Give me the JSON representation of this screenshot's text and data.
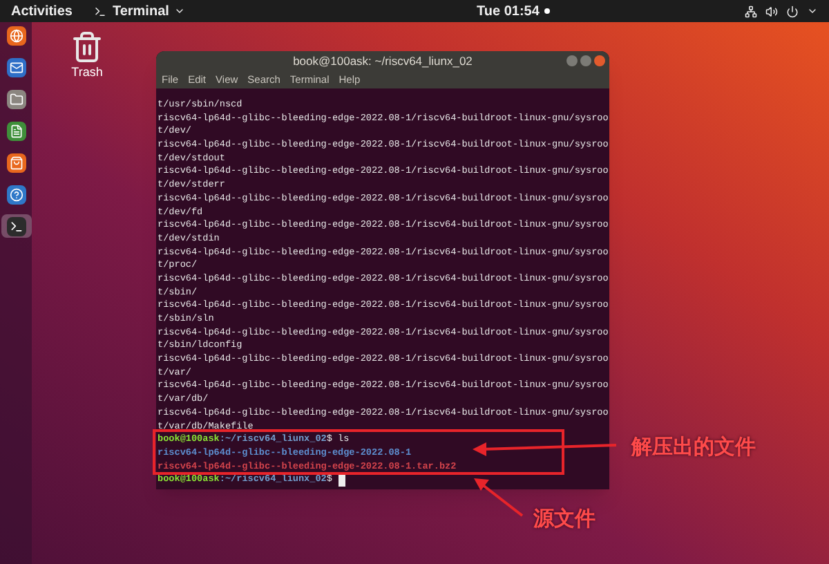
{
  "top_bar": {
    "activities": "Activities",
    "app_menu": "Terminal",
    "clock": "Tue 01:54"
  },
  "dock": {
    "items": [
      {
        "kind": "browser",
        "selected": false
      },
      {
        "kind": "mail",
        "selected": false
      },
      {
        "kind": "files",
        "selected": false
      },
      {
        "kind": "office",
        "selected": false
      },
      {
        "kind": "store",
        "selected": false
      },
      {
        "kind": "help",
        "selected": false
      },
      {
        "kind": "terminal",
        "selected": true
      }
    ]
  },
  "desktop_icons": [
    {
      "label": "Trash"
    }
  ],
  "terminal": {
    "title": "book@100ask: ~/riscv64_liunx_02",
    "menu": [
      "File",
      "Edit",
      "View",
      "Search",
      "Terminal",
      "Help"
    ],
    "lines": [
      {
        "kind": "output",
        "text": "t/usr/sbin/nscd"
      },
      {
        "kind": "output",
        "text": "riscv64-lp64d--glibc--bleeding-edge-2022.08-1/riscv64-buildroot-linux-gnu/sysroo"
      },
      {
        "kind": "output",
        "text": "t/dev/"
      },
      {
        "kind": "output",
        "text": "riscv64-lp64d--glibc--bleeding-edge-2022.08-1/riscv64-buildroot-linux-gnu/sysroo"
      },
      {
        "kind": "output",
        "text": "t/dev/stdout"
      },
      {
        "kind": "output",
        "text": "riscv64-lp64d--glibc--bleeding-edge-2022.08-1/riscv64-buildroot-linux-gnu/sysroo"
      },
      {
        "kind": "output",
        "text": "t/dev/stderr"
      },
      {
        "kind": "output",
        "text": "riscv64-lp64d--glibc--bleeding-edge-2022.08-1/riscv64-buildroot-linux-gnu/sysroo"
      },
      {
        "kind": "output",
        "text": "t/dev/fd"
      },
      {
        "kind": "output",
        "text": "riscv64-lp64d--glibc--bleeding-edge-2022.08-1/riscv64-buildroot-linux-gnu/sysroo"
      },
      {
        "kind": "output",
        "text": "t/dev/stdin"
      },
      {
        "kind": "output",
        "text": "riscv64-lp64d--glibc--bleeding-edge-2022.08-1/riscv64-buildroot-linux-gnu/sysroo"
      },
      {
        "kind": "output",
        "text": "t/proc/"
      },
      {
        "kind": "output",
        "text": "riscv64-lp64d--glibc--bleeding-edge-2022.08-1/riscv64-buildroot-linux-gnu/sysroo"
      },
      {
        "kind": "output",
        "text": "t/sbin/"
      },
      {
        "kind": "output",
        "text": "riscv64-lp64d--glibc--bleeding-edge-2022.08-1/riscv64-buildroot-linux-gnu/sysroo"
      },
      {
        "kind": "output",
        "text": "t/sbin/sln"
      },
      {
        "kind": "output",
        "text": "riscv64-lp64d--glibc--bleeding-edge-2022.08-1/riscv64-buildroot-linux-gnu/sysroo"
      },
      {
        "kind": "output",
        "text": "t/sbin/ldconfig"
      },
      {
        "kind": "output",
        "text": "riscv64-lp64d--glibc--bleeding-edge-2022.08-1/riscv64-buildroot-linux-gnu/sysroo"
      },
      {
        "kind": "output",
        "text": "t/var/"
      },
      {
        "kind": "output",
        "text": "riscv64-lp64d--glibc--bleeding-edge-2022.08-1/riscv64-buildroot-linux-gnu/sysroo"
      },
      {
        "kind": "output",
        "text": "t/var/db/"
      },
      {
        "kind": "output",
        "text": "riscv64-lp64d--glibc--bleeding-edge-2022.08-1/riscv64-buildroot-linux-gnu/sysroo"
      },
      {
        "kind": "output",
        "text": "t/var/db/Makefile"
      },
      {
        "kind": "prompt",
        "user": "book@100ask",
        "path": ":~/riscv64_liunx_02",
        "command": "$ ls",
        "cursor": false
      },
      {
        "kind": "directory",
        "text": "riscv64-lp64d--glibc--bleeding-edge-2022.08-1"
      },
      {
        "kind": "archive",
        "text": "riscv64-lp64d--glibc--bleeding-edge-2022.08-1.tar.bz2"
      },
      {
        "kind": "prompt",
        "user": "book@100ask",
        "path": ":~/riscv64_liunx_02",
        "command": "$ ",
        "cursor": true
      }
    ]
  },
  "annotations": [
    {
      "label": "解压出的文件"
    },
    {
      "label": "源文件"
    }
  ]
}
